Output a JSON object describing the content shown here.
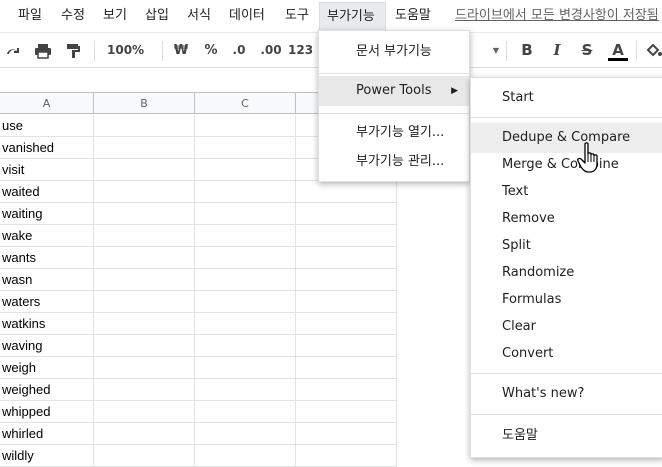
{
  "menubar": {
    "items": [
      "파일",
      "수정",
      "보기",
      "삽입",
      "서식",
      "데이터",
      "도구",
      "부가기능",
      "도움말"
    ],
    "save_status": "드라이브에서 모든 변경사항이 저장됨"
  },
  "toolbar": {
    "zoom": "100%",
    "currency": "₩",
    "percent": "%",
    "dec_decrease": ".0",
    "dec_increase": ".00",
    "number_format": "123",
    "bold": "B",
    "italic": "I",
    "strike": "S",
    "text_color": "A"
  },
  "columns": [
    "A",
    "B",
    "C"
  ],
  "rows": [
    "use",
    "vanished",
    "visit",
    "waited",
    "waiting",
    "wake",
    "wants",
    "wasn",
    "waters",
    "watkins",
    "waving",
    "weigh",
    "weighed",
    "whipped",
    "whirled",
    "wildly"
  ],
  "addons_menu": {
    "items": [
      "문서 부가기능",
      "Power Tools",
      "부가기능 열기...",
      "부가기능 관리..."
    ]
  },
  "power_tools_menu": {
    "items": [
      "Start",
      "Dedupe & Compare",
      "Merge & Combine",
      "Text",
      "Remove",
      "Split",
      "Randomize",
      "Formulas",
      "Clear",
      "Convert",
      "What's new?",
      "도움말"
    ]
  }
}
